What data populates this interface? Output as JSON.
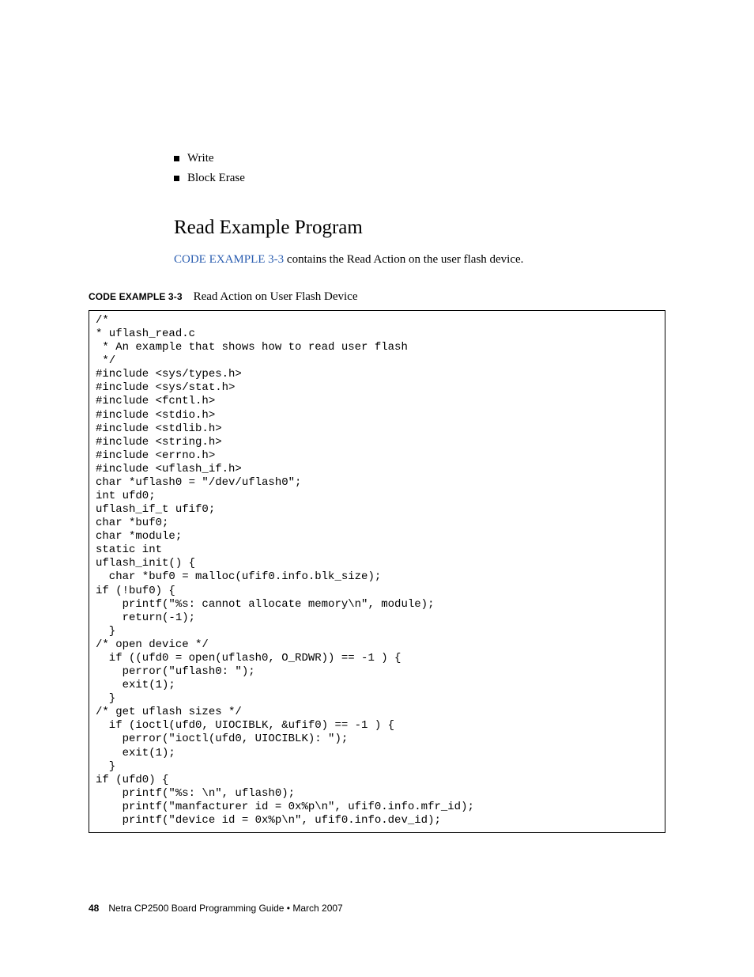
{
  "bullets": {
    "items": [
      "Write",
      "Block Erase"
    ]
  },
  "heading": "Read Example Program",
  "intro": {
    "link": "CODE EXAMPLE 3-3",
    "rest": " contains the Read Action on the user flash device."
  },
  "caption": {
    "label": "CODE EXAMPLE 3-3",
    "text": "Read Action on User Flash Device"
  },
  "code": "/*\n* uflash_read.c\n * An example that shows how to read user flash\n */\n#include <sys/types.h>\n#include <sys/stat.h>\n#include <fcntl.h>\n#include <stdio.h>\n#include <stdlib.h>\n#include <string.h>\n#include <errno.h>\n#include <uflash_if.h>\nchar *uflash0 = \"/dev/uflash0\";\nint ufd0;\nuflash_if_t ufif0;\nchar *buf0;\nchar *module;\nstatic int\nuflash_init() {\n  char *buf0 = malloc(ufif0.info.blk_size);\nif (!buf0) {\n    printf(\"%s: cannot allocate memory\\n\", module);\n    return(-1);\n  }\n/* open device */\n  if ((ufd0 = open(uflash0, O_RDWR)) == -1 ) {\n    perror(\"uflash0: \");\n    exit(1);\n  }\n/* get uflash sizes */\n  if (ioctl(ufd0, UIOCIBLK, &ufif0) == -1 ) {\n    perror(\"ioctl(ufd0, UIOCIBLK): \");\n    exit(1);\n  }\nif (ufd0) {\n    printf(\"%s: \\n\", uflash0);\n    printf(\"manfacturer id = 0x%p\\n\", ufif0.info.mfr_id);\n    printf(\"device id = 0x%p\\n\", ufif0.info.dev_id);",
  "footer": {
    "page": "48",
    "title": "Netra CP2500 Board Programming Guide  •  March 2007"
  }
}
